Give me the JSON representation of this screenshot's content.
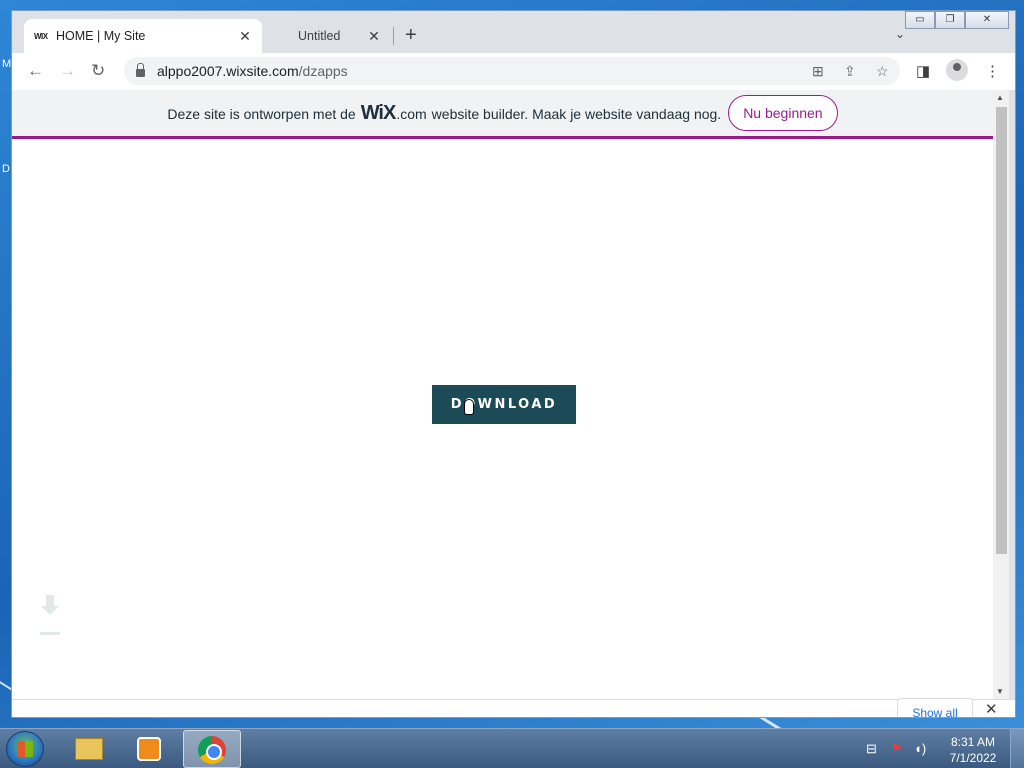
{
  "desktop": {
    "letters": [
      "M",
      "D"
    ]
  },
  "browser": {
    "tabs": [
      {
        "favicon": "WIX",
        "title": "HOME | My Site",
        "active": true
      },
      {
        "title": "Untitled",
        "active": false
      }
    ],
    "new_tab_symbol": "+",
    "tab_search_symbol": "⌄",
    "window_buttons": {
      "minimize": "▭",
      "restore": "❐",
      "close": "✕"
    },
    "address": {
      "host": "alppo2007.wixsite.com",
      "path": "/dzapps"
    }
  },
  "page": {
    "banner": {
      "text_before": "Deze site is ontworpen met de",
      "logo": "WiX",
      "logo_suffix": ".com",
      "text_after": "website builder. Maak je website vandaag nog.",
      "button_label": "Nu beginnen",
      "accent_color": "#9a1a8e"
    },
    "download_button": {
      "label": "DOWNLOAD",
      "color": "#1c4a56"
    }
  },
  "downloads_bar": {
    "show_all": "Show all",
    "close": "✕"
  },
  "taskbar": {
    "time": "8:31 AM",
    "date": "7/1/2022"
  }
}
